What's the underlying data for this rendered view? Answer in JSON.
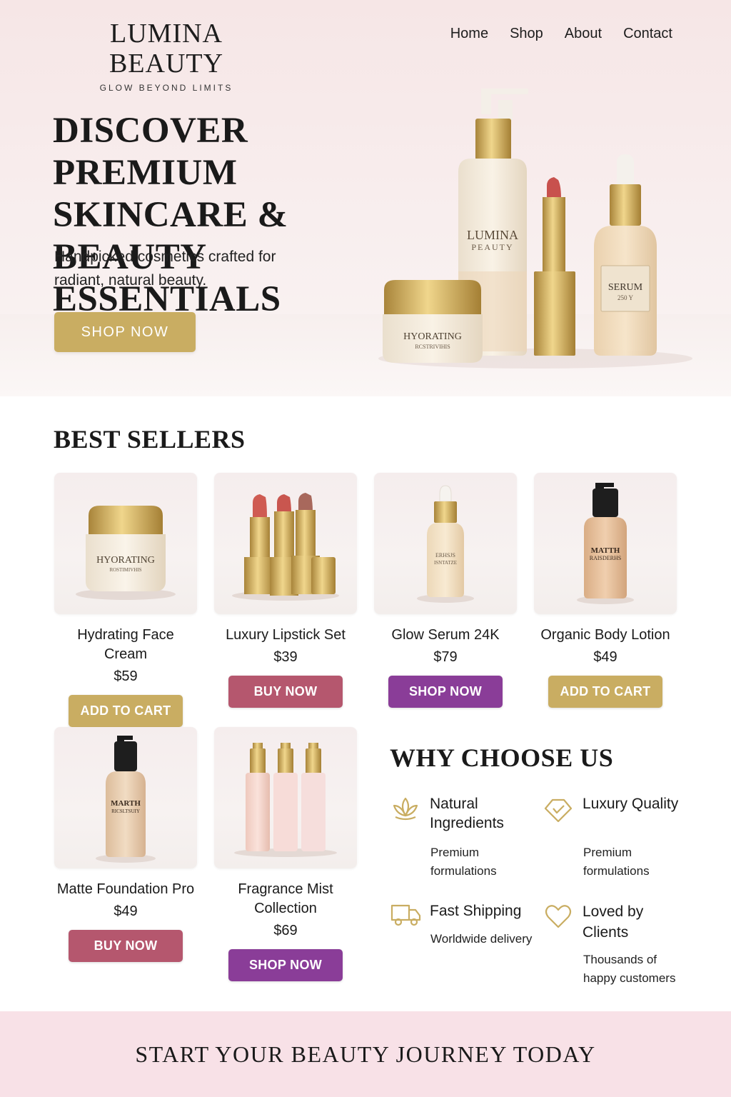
{
  "brand": {
    "name": "LUMINA BEAUTY",
    "tagline": "GLOW BEYOND LIMITS"
  },
  "nav": {
    "items": [
      "Home",
      "Shop",
      "About",
      "Contact"
    ]
  },
  "hero": {
    "title": "DISCOVER PREMIUM SKINCARE & BEAUTY ESSENTIALS",
    "subtitle": "Handpicked cosmetics crafted for radiant, natural beauty.",
    "cta_label": "SHOP NOW",
    "product_labels": {
      "bottle_top": "LUMINA",
      "bottle_bottom": "PEAUTY",
      "jar_top": "HYORATING",
      "jar_bottom": "RCSTRIVIHIS",
      "serum_top": "SERUM",
      "serum_bottom": "250 Y"
    }
  },
  "best_sellers": {
    "title": "BEST SELLERS",
    "products": [
      {
        "name": "Hydrating Face Cream",
        "price": "$59",
        "button": "ADD TO CART",
        "button_style": "gold",
        "icon": "face-cream-jar",
        "label_top": "HYORATING",
        "label_bottom": "ROSTIMIVHIS"
      },
      {
        "name": "Luxury Lipstick Set",
        "price": "$39",
        "button": "BUY NOW",
        "button_style": "rose",
        "icon": "lipstick-set"
      },
      {
        "name": "Glow Serum 24K",
        "price": "$79",
        "button": "SHOP NOW",
        "button_style": "purple",
        "icon": "serum-dropper-bottle",
        "label_top": "ERHSJS",
        "label_bottom": "ISNTATZE"
      },
      {
        "name": "Organic Body Lotion",
        "price": "$49",
        "button": "ADD TO CART",
        "button_style": "gold",
        "icon": "lotion-pump-bottle",
        "label_top": "MATTH",
        "label_bottom": "RAISDERHS"
      },
      {
        "name": "Matte Foundation Pro",
        "price": "$49",
        "button": "BUY NOW",
        "button_style": "rose",
        "icon": "foundation-bottle",
        "label_top": "MARTH",
        "label_bottom": "RICSLTSUIY"
      },
      {
        "name": "Fragrance Mist Collection",
        "price": "$69",
        "button": "SHOP NOW",
        "button_style": "purple",
        "icon": "mist-spray-bottles"
      }
    ]
  },
  "why": {
    "title": "WHY CHOOSE US",
    "features": [
      {
        "title": "Natural Ingredients",
        "desc": "Premium formulations",
        "icon": "lotus-icon"
      },
      {
        "title": "Luxury Quality",
        "desc": "Premium formulations",
        "icon": "diamond-icon"
      },
      {
        "title": "Fast Shipping",
        "desc": "Worldwide delivery",
        "icon": "truck-icon"
      },
      {
        "title": "Loved by Clients",
        "desc": "Thousands of happy customers",
        "icon": "heart-icon"
      }
    ]
  },
  "cta_banner": {
    "text": "START YOUR BEAUTY JOURNEY TODAY"
  },
  "colors": {
    "gold": "#c9ad62",
    "rose": "#b5576e",
    "purple": "#8a3d98",
    "banner_pink": "#f8e1e7"
  }
}
